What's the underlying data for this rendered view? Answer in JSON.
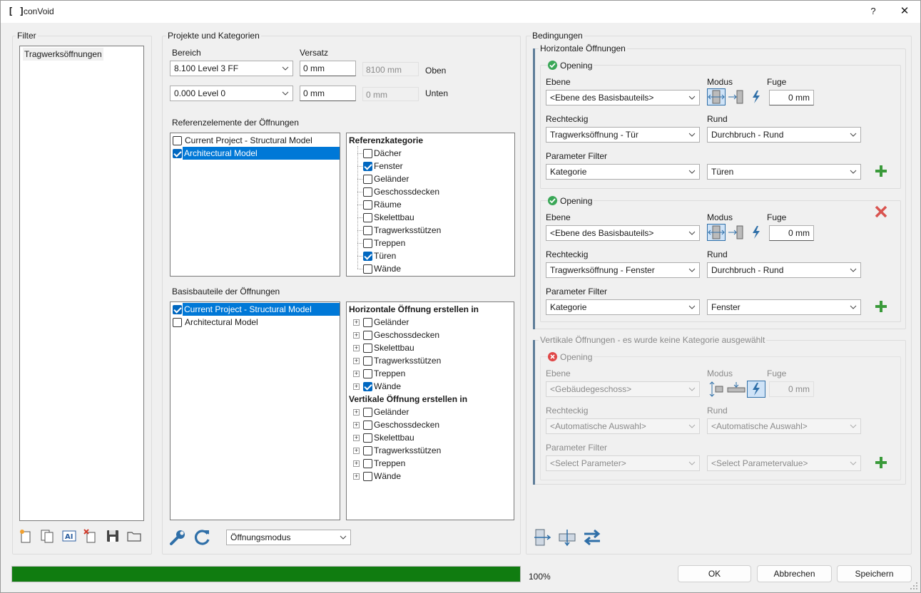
{
  "window": {
    "title": "conVoid",
    "help": "?",
    "close": "✕"
  },
  "filter": {
    "group_label": "Filter",
    "items": [
      "Tragwerksöffnungen"
    ]
  },
  "projects": {
    "group_label": "Projekte und Kategorien",
    "bereich_label": "Bereich",
    "versatz_label": "Versatz",
    "top": {
      "level": "8.100  Level 3 FF",
      "offset": "0 mm",
      "computed": "8100 mm",
      "side": "Oben"
    },
    "bottom": {
      "level": "0.000  Level 0",
      "offset": "0 mm",
      "computed": "0 mm",
      "side": "Unten"
    },
    "ref_label": "Referenzelemente der Öffnungen",
    "ref_models": [
      {
        "label": "Current Project - Structural Model",
        "checked": false
      },
      {
        "label": "Architectural Model",
        "checked": true
      }
    ],
    "ref_category_title": "Referenzkategorie",
    "ref_categories": [
      {
        "label": "Dächer",
        "checked": false
      },
      {
        "label": "Fenster",
        "checked": true
      },
      {
        "label": "Geländer",
        "checked": false
      },
      {
        "label": "Geschossdecken",
        "checked": false
      },
      {
        "label": "Räume",
        "checked": false
      },
      {
        "label": "Skelettbau",
        "checked": false
      },
      {
        "label": "Tragwerksstützen",
        "checked": false
      },
      {
        "label": "Treppen",
        "checked": false
      },
      {
        "label": "Türen",
        "checked": true
      },
      {
        "label": "Wände",
        "checked": false
      }
    ],
    "base_label": "Basisbauteile der Öffnungen",
    "base_models": [
      {
        "label": "Current Project - Structural Model",
        "checked": true
      },
      {
        "label": "Architectural Model",
        "checked": false
      }
    ],
    "horizontal_title": "Horizontale Öffnung erstellen in",
    "horizontal_items": [
      {
        "label": "Geländer",
        "checked": false
      },
      {
        "label": "Geschossdecken",
        "checked": false
      },
      {
        "label": "Skelettbau",
        "checked": false
      },
      {
        "label": "Tragwerksstützen",
        "checked": false
      },
      {
        "label": "Treppen",
        "checked": false
      },
      {
        "label": "Wände",
        "checked": true
      }
    ],
    "vertical_title": "Vertikale Öffnung erstellen in",
    "vertical_items": [
      {
        "label": "Geländer",
        "checked": false
      },
      {
        "label": "Geschossdecken",
        "checked": false
      },
      {
        "label": "Skelettbau",
        "checked": false
      },
      {
        "label": "Tragwerksstützen",
        "checked": false
      },
      {
        "label": "Treppen",
        "checked": false
      },
      {
        "label": "Wände",
        "checked": false
      }
    ],
    "mode_select": "Öffnungsmodus"
  },
  "conditions": {
    "group_label": "Bedingungen",
    "horizontal_label": "Horizontale Öffnungen",
    "vertical_label": "Vertikale Öffnungen - es wurde keine Kategorie ausgewählt",
    "col_ebene": "Ebene",
    "col_modus": "Modus",
    "col_fuge": "Fuge",
    "col_rechteckig": "Rechteckig",
    "col_rund": "Rund",
    "col_param": "Parameter Filter",
    "openings": [
      {
        "title": "Opening",
        "ebene": "<Ebene des Basisbauteils>",
        "fuge": "0 mm",
        "rechteckig": "Tragwerksöffnung - Tür",
        "rund": "Durchbruch - Rund",
        "param": "Kategorie",
        "param_value": "Türen"
      },
      {
        "title": "Opening",
        "ebene": "<Ebene des Basisbauteils>",
        "fuge": "0 mm",
        "rechteckig": "Tragwerksöffnung - Fenster",
        "rund": "Durchbruch - Rund",
        "param": "Kategorie",
        "param_value": "Fenster"
      }
    ],
    "vertical_opening": {
      "title": "Opening",
      "ebene": "<Gebäudegeschoss>",
      "fuge": "0 mm",
      "rechteckig": "<Automatische Auswahl>",
      "rund": "<Automatische Auswahl>",
      "param": "<Select Parameter>",
      "param_value": "<Select Parametervalue>"
    }
  },
  "footer": {
    "progress": 1.0,
    "progress_text": "100%",
    "ok": "OK",
    "cancel": "Abbrechen",
    "save": "Speichern"
  },
  "colors": {
    "accent": "#0078d7",
    "progress": "#107c10",
    "add": "#3a9a3a",
    "remove": "#d9534f",
    "ok": "#3aa757"
  }
}
